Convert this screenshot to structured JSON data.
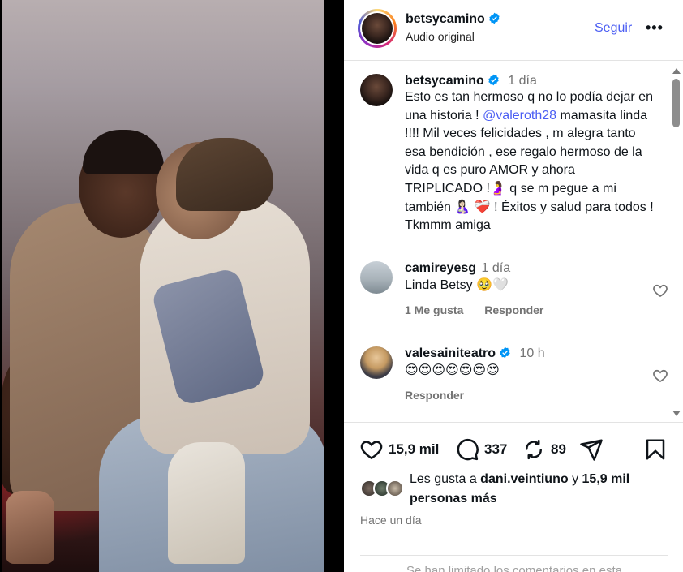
{
  "header": {
    "username": "betsycamino",
    "subtitle": "Audio original",
    "follow_label": "Seguir",
    "more_label": "•••"
  },
  "caption": {
    "username": "betsycamino",
    "time": "1 día",
    "text_before": "Esto es tan hermoso q no lo podía dejar en una historia ! ",
    "mention": "@valeroth28",
    "text_after": " mamasita linda !!!! Mil veces felicidades , m alegra tanto esa bendición , ese regalo hermoso de la vida q es puro AMOR y ahora TRIPLICADO !🤰 q se m pegue a mi también 🤱🏻 ❤️‍🩹 ! Éxitos y salud para todos ! Tkmmm amiga"
  },
  "comments": [
    {
      "username": "camireyesg",
      "time": "1 día",
      "text": "Linda Betsy 🥹🤍",
      "likes_label": "1 Me gusta",
      "reply_label": "Responder"
    },
    {
      "username": "valesainiteatro",
      "time": "10 h",
      "text": "😍😍😍😍😍😍😍",
      "reply_label": "Responder"
    }
  ],
  "actions": {
    "like_count": "15,9 mil",
    "comment_count": "337",
    "repost_count": "89"
  },
  "likes": {
    "prefix": "Les gusta a ",
    "user": "dani.veintiuno",
    "middle": " y ",
    "count": "15,9 mil personas más"
  },
  "time_ago": "Hace un día",
  "limited_text": "Se han limitado los comentarios en esta",
  "colors": {
    "accent": "#4a5df3",
    "verified": "#0095f6",
    "muted": "#737373"
  }
}
